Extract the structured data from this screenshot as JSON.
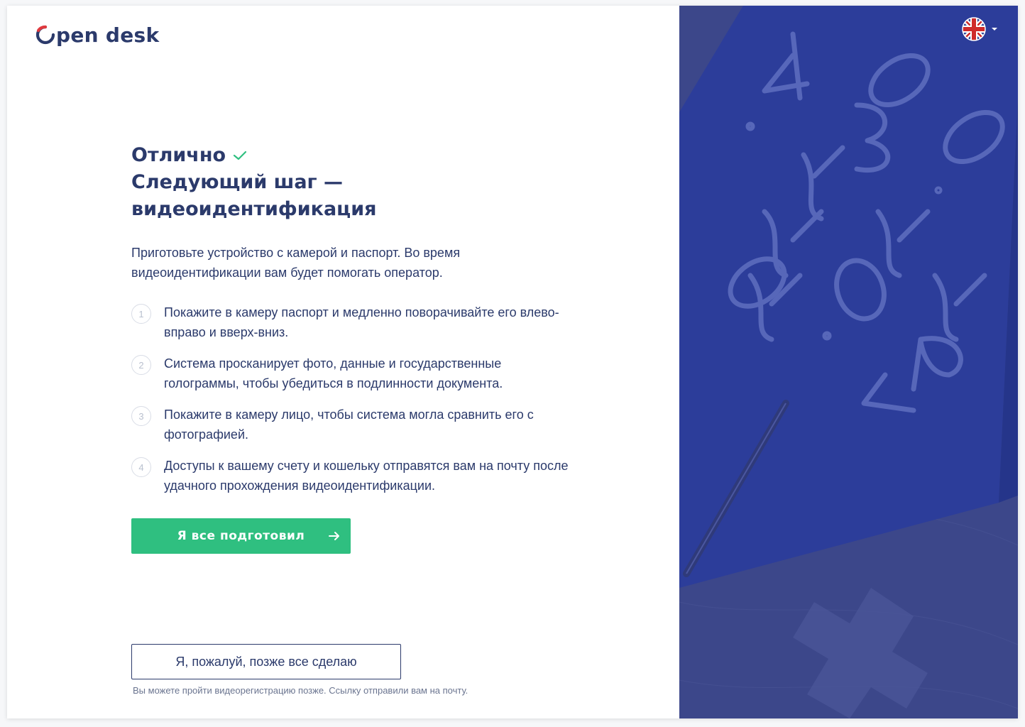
{
  "brand": {
    "logo_text": "pen desk",
    "logo_mark": "O"
  },
  "main": {
    "title_line1": "Отлично",
    "title_line2": "Следующий шаг — видеоидентификация",
    "intro": "Приготовьте устройство с камерой и паспорт. Во время видеоидентификации вам будет помогать оператор.",
    "steps": [
      {
        "num": "1",
        "text": "Покажите в камеру паспорт и медленно поворачивайте его влево-вправо и вверх-вниз."
      },
      {
        "num": "2",
        "text": "Система просканирует фото, данные и государственные голограммы, чтобы убедиться в подлинности документа."
      },
      {
        "num": "3",
        "text": "Покажите в камеру лицо, чтобы система могла сравнить его с фотографией."
      },
      {
        "num": "4",
        "text": "Доступы к вашему счету и кошельку отправятся вам на почту после удачного прохождения видеоидентификации."
      }
    ]
  },
  "actions": {
    "primary_label": "Я все подготовил",
    "secondary_label": "Я, пожалуй, позже все сделаю",
    "hint": "Вы можете пройти видеорегистрацию позже. Ссылку отправили вам на почту."
  },
  "icons": {
    "check": "check-icon",
    "arrow": "arrow-right-icon",
    "language": "uk-flag-icon",
    "caret": "caret-down-icon"
  },
  "colors": {
    "primary": "#2fbf80",
    "text": "#2b3a6b",
    "accent_red": "#e0393e",
    "panel": "#3e4a8e"
  }
}
